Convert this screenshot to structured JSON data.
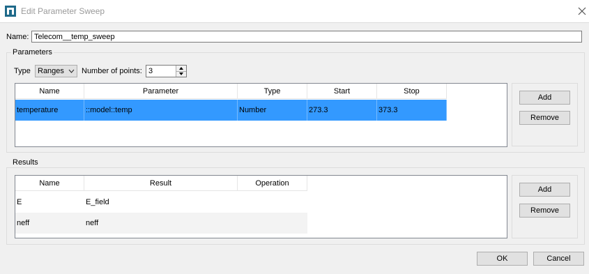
{
  "window": {
    "title": "Edit Parameter Sweep"
  },
  "name_row": {
    "label": "Name:",
    "value": "Telecom__temp_sweep"
  },
  "parameters": {
    "group_title": "Parameters",
    "type_label": "Type",
    "type_value": "Ranges",
    "points_label": "Number of points:",
    "points_value": "3",
    "columns": [
      "Name",
      "Parameter",
      "Type",
      "Start",
      "Stop"
    ],
    "rows": [
      {
        "name": "temperature",
        "parameter": "::model::temp",
        "type": "Number",
        "start": "273.3",
        "stop": "373.3",
        "selected": true
      }
    ],
    "add_label": "Add",
    "remove_label": "Remove"
  },
  "results": {
    "group_title": "Results",
    "columns": [
      "Name",
      "Result",
      "Operation"
    ],
    "rows": [
      {
        "name": "E",
        "result": "E_field",
        "operation": ""
      },
      {
        "name": "neff",
        "result": "neff",
        "operation": ""
      }
    ],
    "add_label": "Add",
    "remove_label": "Remove"
  },
  "footer": {
    "ok_label": "OK",
    "cancel_label": "Cancel"
  },
  "colors": {
    "selection": "#3399ff",
    "accent": "#0078d7"
  },
  "icons": {
    "app": "app-logo-icon",
    "close": "close-icon",
    "dropdown": "chevron-down-icon",
    "spin_up": "spin-up-icon",
    "spin_down": "spin-down-icon"
  }
}
